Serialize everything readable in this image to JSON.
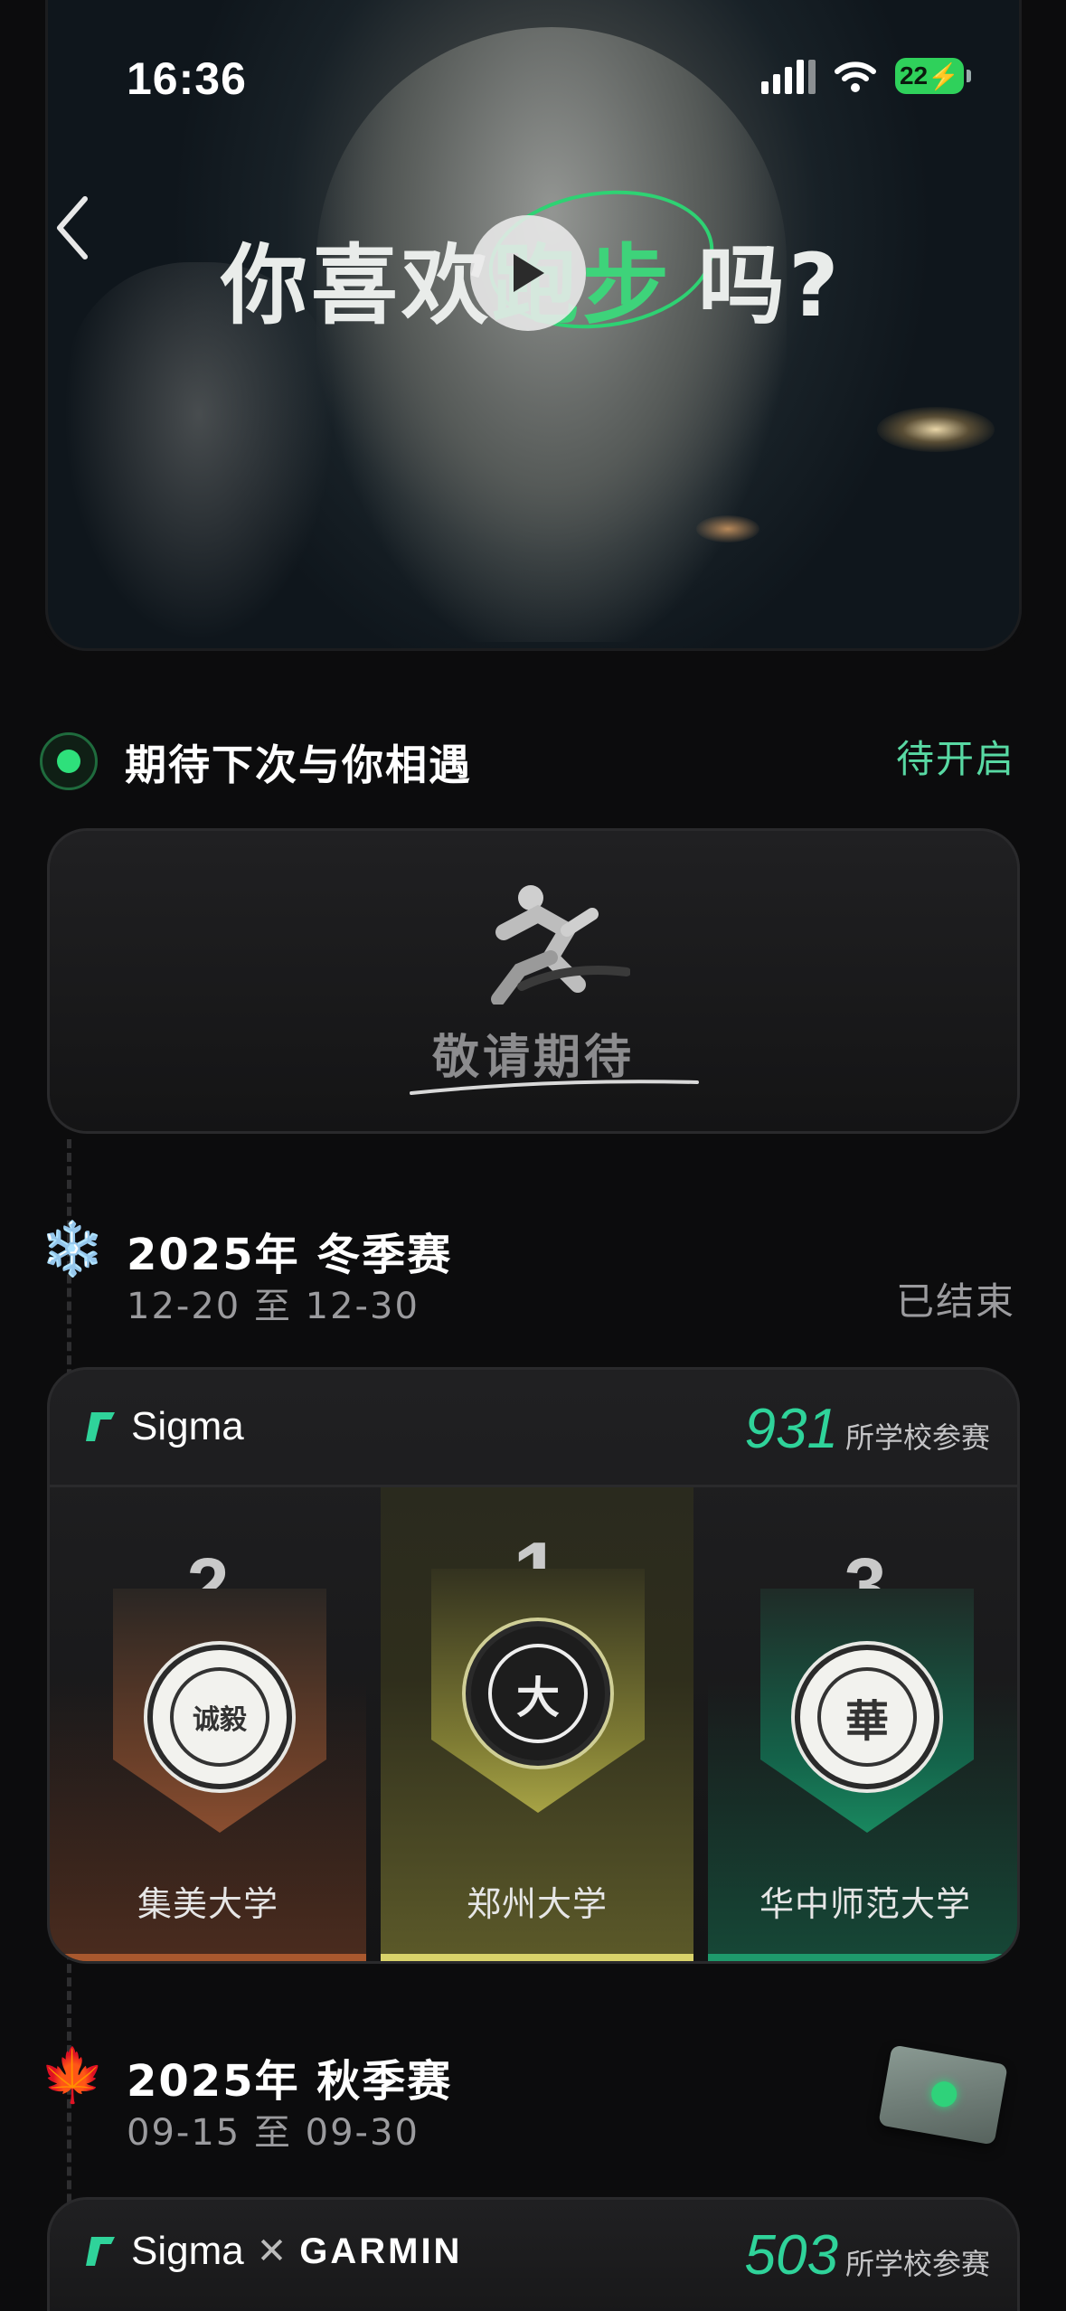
{
  "status_bar": {
    "time": "16:36",
    "battery": "22"
  },
  "hero": {
    "title_prefix": "你喜欢",
    "title_highlight": "跑步",
    "title_suffix": "吗?"
  },
  "upcoming": {
    "title": "期待下次与你相遇",
    "status": "待开启",
    "placeholder_text": "敬请期待"
  },
  "seasons": [
    {
      "title": "2025年 冬季赛",
      "dates": "12-20 至 12-30",
      "status": "已结束",
      "icon": "snowflake-icon",
      "brand": "Sigma",
      "school_count": "931",
      "school_count_label": "所学校参赛",
      "podium": [
        {
          "rank": "2",
          "school": "集美大学",
          "seal_char": "诚毅"
        },
        {
          "rank": "1",
          "school": "郑州大学",
          "seal_char": "大"
        },
        {
          "rank": "3",
          "school": "华中师范大学",
          "seal_char": "華"
        }
      ]
    },
    {
      "title": "2025年 秋季赛",
      "dates": "09-15 至 09-30",
      "icon": "maple-leaf-icon",
      "brand": "Sigma",
      "partner": "GARMIN",
      "school_count": "503",
      "school_count_label": "所学校参赛"
    }
  ],
  "colors": {
    "accent_green": "#2fd39a",
    "gold": "#d9d36a",
    "bronze": "#a9582e",
    "teal": "#1e9a6c"
  }
}
